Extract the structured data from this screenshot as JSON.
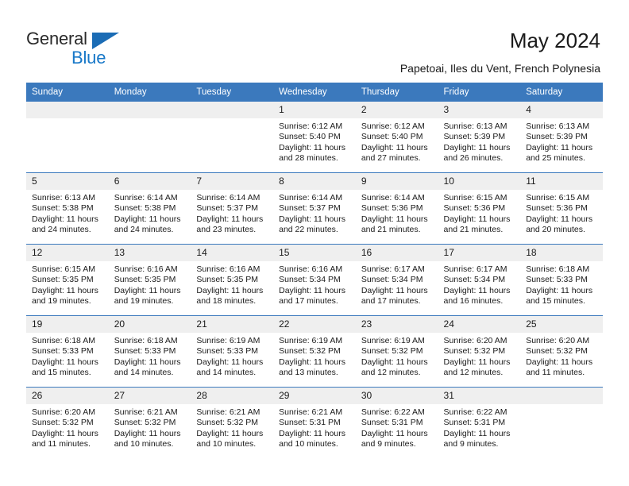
{
  "brand": {
    "name_top": "General",
    "name_bottom": "Blue",
    "triangle_icon": "brand-triangle-icon",
    "color_primary": "#1878c8",
    "color_text": "#2b2b2b"
  },
  "header": {
    "title": "May 2024",
    "subtitle": "Papetoai, Iles du Vent, French Polynesia"
  },
  "calendar": {
    "accent_color": "#3b79bd",
    "daynum_bg": "#efefef",
    "weekday_headers": [
      "Sunday",
      "Monday",
      "Tuesday",
      "Wednesday",
      "Thursday",
      "Friday",
      "Saturday"
    ],
    "weeks": [
      [
        {
          "day": "",
          "lines": []
        },
        {
          "day": "",
          "lines": []
        },
        {
          "day": "",
          "lines": []
        },
        {
          "day": "1",
          "lines": [
            "Sunrise: 6:12 AM",
            "Sunset: 5:40 PM",
            "Daylight: 11 hours",
            "and 28 minutes."
          ]
        },
        {
          "day": "2",
          "lines": [
            "Sunrise: 6:12 AM",
            "Sunset: 5:40 PM",
            "Daylight: 11 hours",
            "and 27 minutes."
          ]
        },
        {
          "day": "3",
          "lines": [
            "Sunrise: 6:13 AM",
            "Sunset: 5:39 PM",
            "Daylight: 11 hours",
            "and 26 minutes."
          ]
        },
        {
          "day": "4",
          "lines": [
            "Sunrise: 6:13 AM",
            "Sunset: 5:39 PM",
            "Daylight: 11 hours",
            "and 25 minutes."
          ]
        }
      ],
      [
        {
          "day": "5",
          "lines": [
            "Sunrise: 6:13 AM",
            "Sunset: 5:38 PM",
            "Daylight: 11 hours",
            "and 24 minutes."
          ]
        },
        {
          "day": "6",
          "lines": [
            "Sunrise: 6:14 AM",
            "Sunset: 5:38 PM",
            "Daylight: 11 hours",
            "and 24 minutes."
          ]
        },
        {
          "day": "7",
          "lines": [
            "Sunrise: 6:14 AM",
            "Sunset: 5:37 PM",
            "Daylight: 11 hours",
            "and 23 minutes."
          ]
        },
        {
          "day": "8",
          "lines": [
            "Sunrise: 6:14 AM",
            "Sunset: 5:37 PM",
            "Daylight: 11 hours",
            "and 22 minutes."
          ]
        },
        {
          "day": "9",
          "lines": [
            "Sunrise: 6:14 AM",
            "Sunset: 5:36 PM",
            "Daylight: 11 hours",
            "and 21 minutes."
          ]
        },
        {
          "day": "10",
          "lines": [
            "Sunrise: 6:15 AM",
            "Sunset: 5:36 PM",
            "Daylight: 11 hours",
            "and 21 minutes."
          ]
        },
        {
          "day": "11",
          "lines": [
            "Sunrise: 6:15 AM",
            "Sunset: 5:36 PM",
            "Daylight: 11 hours",
            "and 20 minutes."
          ]
        }
      ],
      [
        {
          "day": "12",
          "lines": [
            "Sunrise: 6:15 AM",
            "Sunset: 5:35 PM",
            "Daylight: 11 hours",
            "and 19 minutes."
          ]
        },
        {
          "day": "13",
          "lines": [
            "Sunrise: 6:16 AM",
            "Sunset: 5:35 PM",
            "Daylight: 11 hours",
            "and 19 minutes."
          ]
        },
        {
          "day": "14",
          "lines": [
            "Sunrise: 6:16 AM",
            "Sunset: 5:35 PM",
            "Daylight: 11 hours",
            "and 18 minutes."
          ]
        },
        {
          "day": "15",
          "lines": [
            "Sunrise: 6:16 AM",
            "Sunset: 5:34 PM",
            "Daylight: 11 hours",
            "and 17 minutes."
          ]
        },
        {
          "day": "16",
          "lines": [
            "Sunrise: 6:17 AM",
            "Sunset: 5:34 PM",
            "Daylight: 11 hours",
            "and 17 minutes."
          ]
        },
        {
          "day": "17",
          "lines": [
            "Sunrise: 6:17 AM",
            "Sunset: 5:34 PM",
            "Daylight: 11 hours",
            "and 16 minutes."
          ]
        },
        {
          "day": "18",
          "lines": [
            "Sunrise: 6:18 AM",
            "Sunset: 5:33 PM",
            "Daylight: 11 hours",
            "and 15 minutes."
          ]
        }
      ],
      [
        {
          "day": "19",
          "lines": [
            "Sunrise: 6:18 AM",
            "Sunset: 5:33 PM",
            "Daylight: 11 hours",
            "and 15 minutes."
          ]
        },
        {
          "day": "20",
          "lines": [
            "Sunrise: 6:18 AM",
            "Sunset: 5:33 PM",
            "Daylight: 11 hours",
            "and 14 minutes."
          ]
        },
        {
          "day": "21",
          "lines": [
            "Sunrise: 6:19 AM",
            "Sunset: 5:33 PM",
            "Daylight: 11 hours",
            "and 14 minutes."
          ]
        },
        {
          "day": "22",
          "lines": [
            "Sunrise: 6:19 AM",
            "Sunset: 5:32 PM",
            "Daylight: 11 hours",
            "and 13 minutes."
          ]
        },
        {
          "day": "23",
          "lines": [
            "Sunrise: 6:19 AM",
            "Sunset: 5:32 PM",
            "Daylight: 11 hours",
            "and 12 minutes."
          ]
        },
        {
          "day": "24",
          "lines": [
            "Sunrise: 6:20 AM",
            "Sunset: 5:32 PM",
            "Daylight: 11 hours",
            "and 12 minutes."
          ]
        },
        {
          "day": "25",
          "lines": [
            "Sunrise: 6:20 AM",
            "Sunset: 5:32 PM",
            "Daylight: 11 hours",
            "and 11 minutes."
          ]
        }
      ],
      [
        {
          "day": "26",
          "lines": [
            "Sunrise: 6:20 AM",
            "Sunset: 5:32 PM",
            "Daylight: 11 hours",
            "and 11 minutes."
          ]
        },
        {
          "day": "27",
          "lines": [
            "Sunrise: 6:21 AM",
            "Sunset: 5:32 PM",
            "Daylight: 11 hours",
            "and 10 minutes."
          ]
        },
        {
          "day": "28",
          "lines": [
            "Sunrise: 6:21 AM",
            "Sunset: 5:32 PM",
            "Daylight: 11 hours",
            "and 10 minutes."
          ]
        },
        {
          "day": "29",
          "lines": [
            "Sunrise: 6:21 AM",
            "Sunset: 5:31 PM",
            "Daylight: 11 hours",
            "and 10 minutes."
          ]
        },
        {
          "day": "30",
          "lines": [
            "Sunrise: 6:22 AM",
            "Sunset: 5:31 PM",
            "Daylight: 11 hours",
            "and 9 minutes."
          ]
        },
        {
          "day": "31",
          "lines": [
            "Sunrise: 6:22 AM",
            "Sunset: 5:31 PM",
            "Daylight: 11 hours",
            "and 9 minutes."
          ]
        },
        {
          "day": "",
          "lines": []
        }
      ]
    ]
  }
}
